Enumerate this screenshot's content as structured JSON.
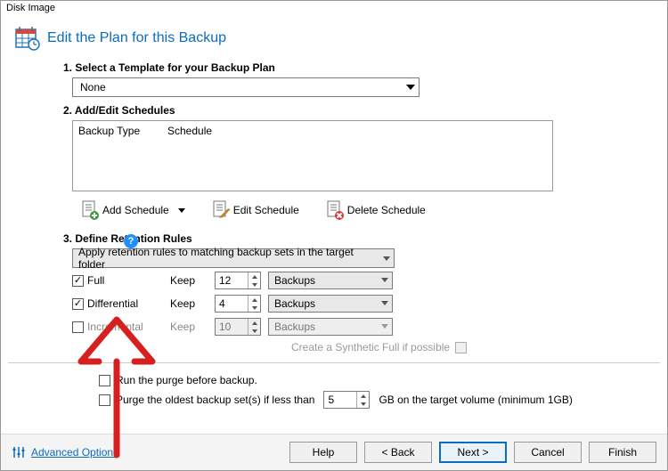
{
  "window": {
    "title": "Disk Image"
  },
  "header": {
    "title": "Edit the Plan for this Backup"
  },
  "steps": {
    "s1": {
      "num": "1.",
      "title": "Select a Template for your Backup Plan"
    },
    "s2": {
      "num": "2.",
      "title": "Add/Edit Schedules"
    },
    "s3": {
      "num": "3.",
      "title": "Define Retention Rules"
    }
  },
  "template": {
    "value": "None"
  },
  "sched_table": {
    "col1": "Backup Type",
    "col2": "Schedule"
  },
  "toolbar": {
    "add": "Add Schedule",
    "edit": "Edit Schedule",
    "del": "Delete Schedule"
  },
  "retention": {
    "rule_scope": "Apply retention rules to matching backup sets in the target folder",
    "keep_label": "Keep",
    "unit": "Backups",
    "rows": {
      "full": {
        "label": "Full",
        "val": "12",
        "checked": true,
        "enabled": true
      },
      "diff": {
        "label": "Differential",
        "val": "4",
        "checked": true,
        "enabled": true
      },
      "incr": {
        "label": "Incremental",
        "val": "10",
        "checked": false,
        "enabled": false
      }
    },
    "synth": "Create a Synthetic Full if possible"
  },
  "purge": {
    "before": "Run the purge before backup.",
    "oldest_prefix": "Purge the oldest backup set(s) if less than",
    "oldest_val": "5",
    "oldest_suffix": "GB on the target volume (minimum 1GB)"
  },
  "footer": {
    "advanced": "Advanced Options",
    "help": "Help",
    "back": "< Back",
    "next": "Next >",
    "cancel": "Cancel",
    "finish": "Finish"
  },
  "help_badge": "?"
}
